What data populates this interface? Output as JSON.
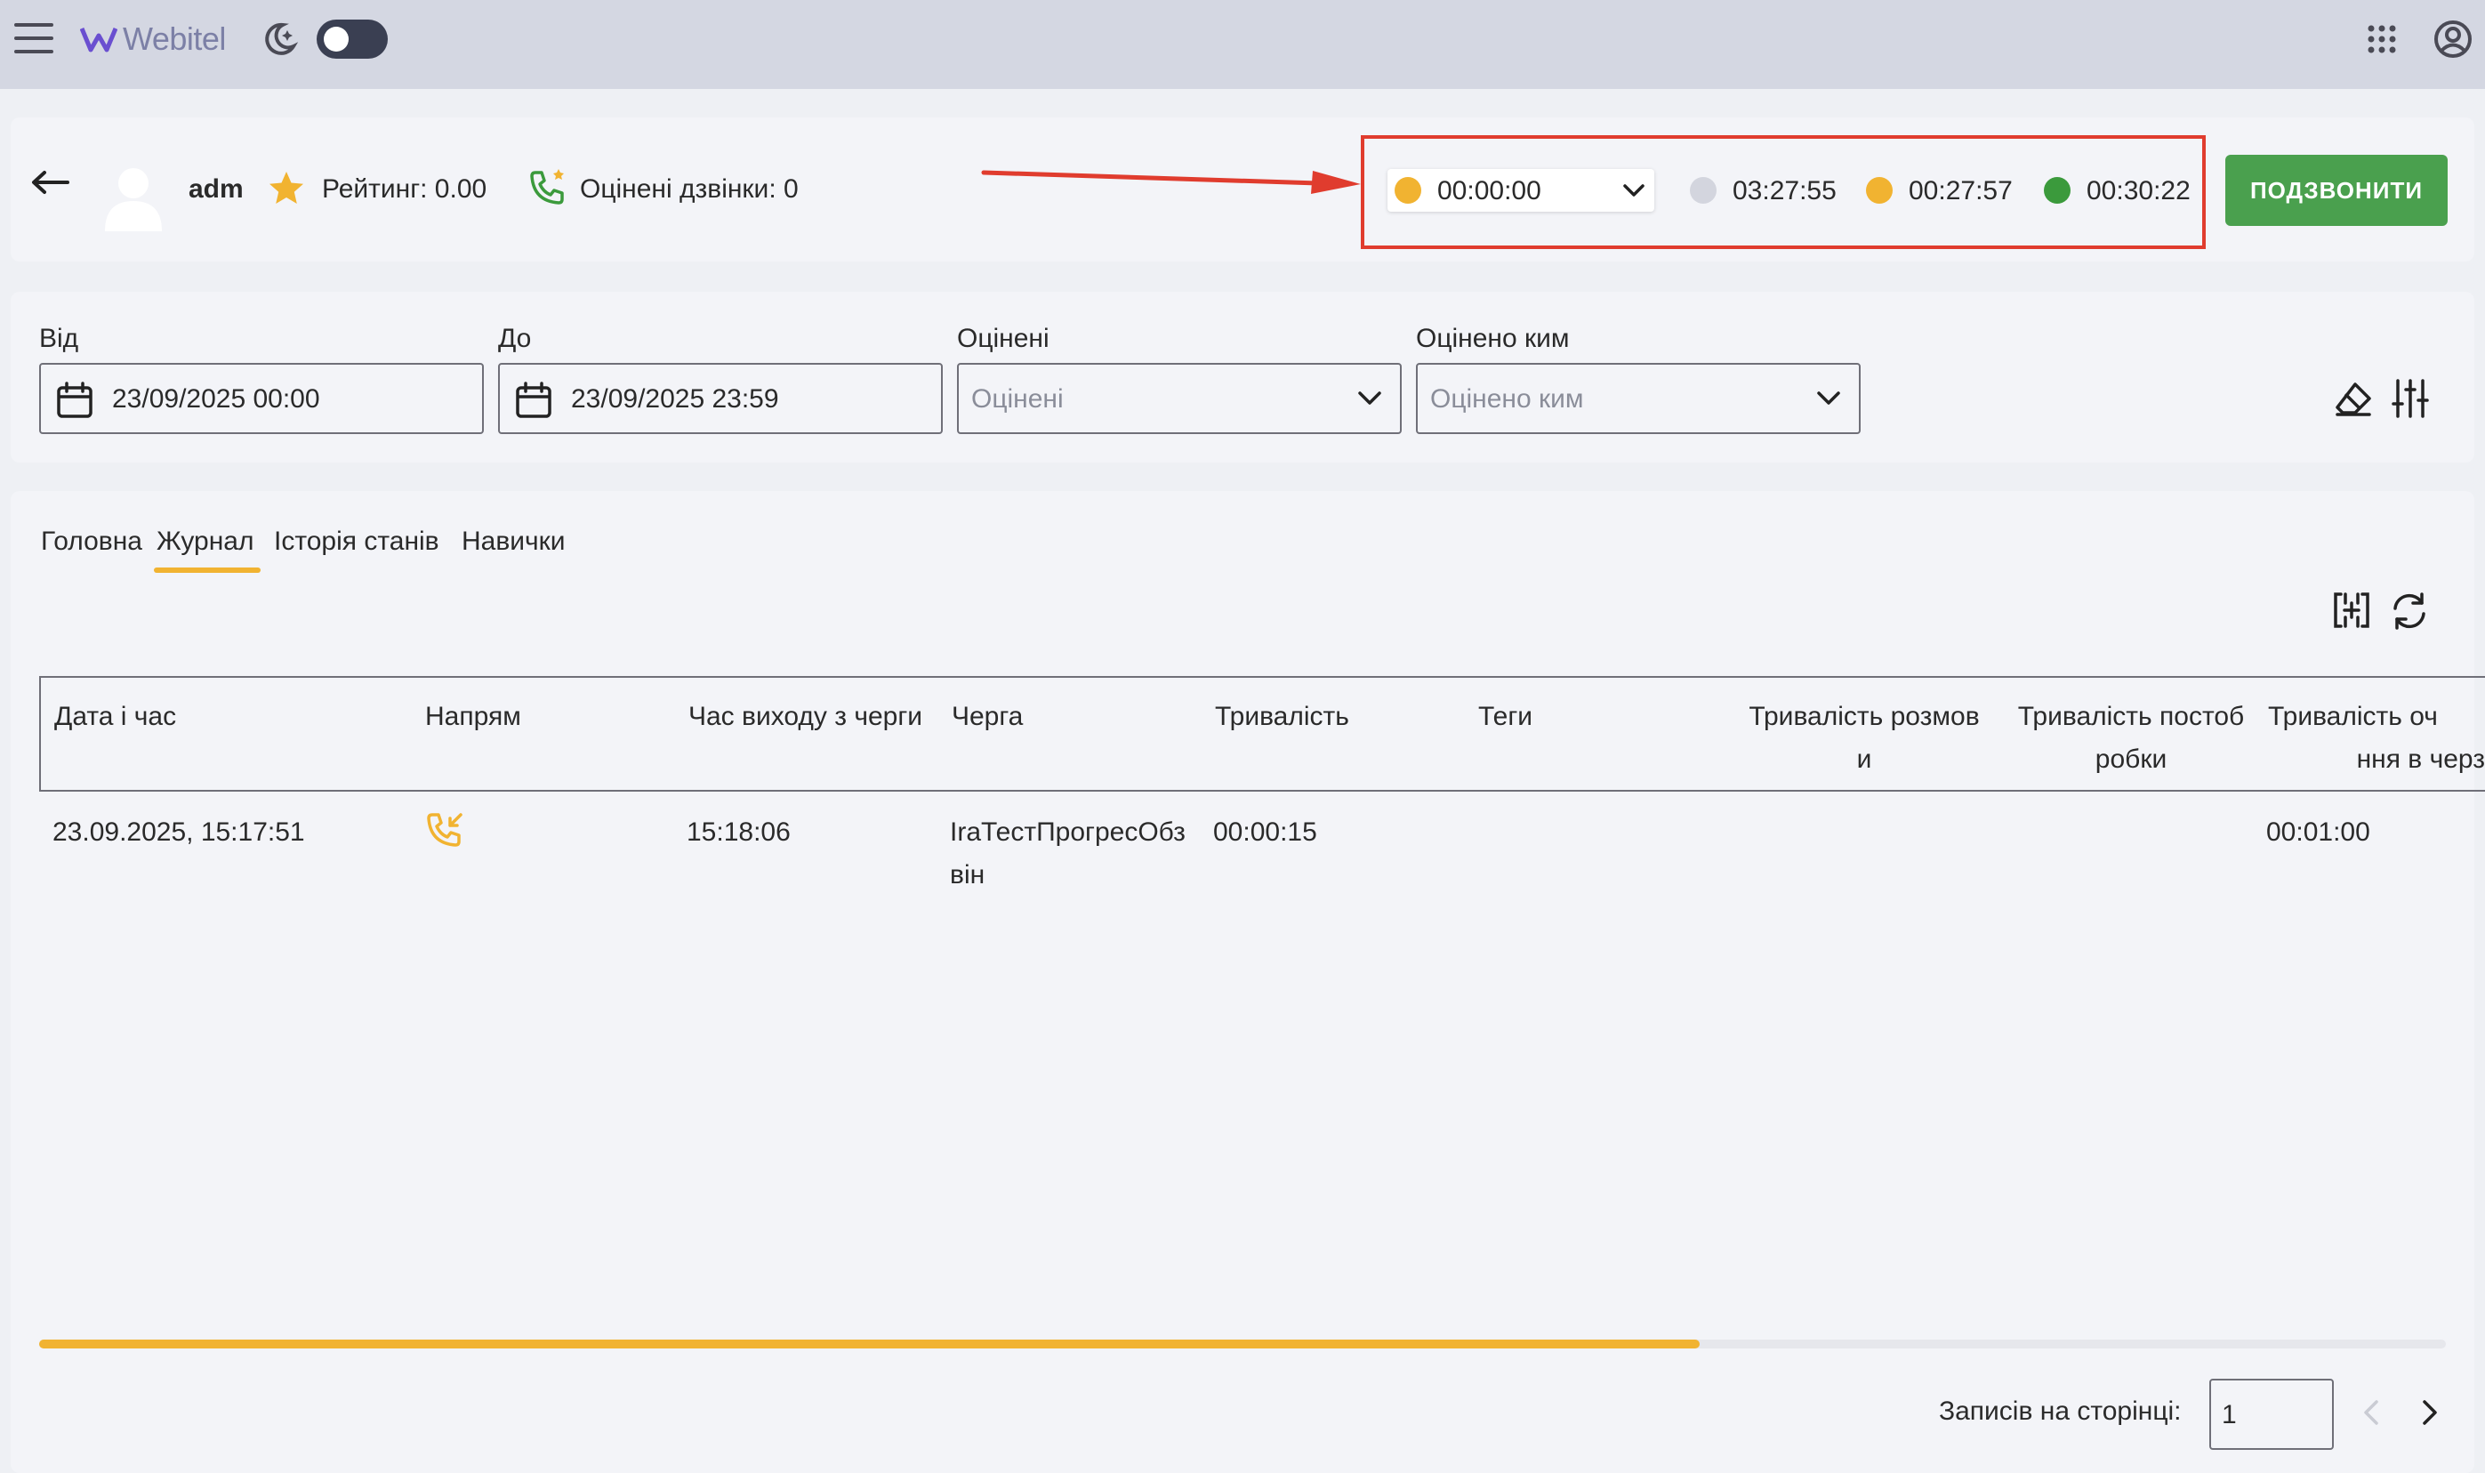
{
  "topbar": {
    "logo_text": "Webitel"
  },
  "agent": {
    "name": "adm",
    "rating": "Рейтинг: 0.00",
    "rated_calls": "Оцінені дзвінки: 0"
  },
  "status": {
    "current": "00:00:00",
    "current_color": "#f1b331",
    "timers": [
      {
        "value": "03:27:55",
        "color": "#d3d5de"
      },
      {
        "value": "00:27:57",
        "color": "#f1b331"
      },
      {
        "value": "00:30:22",
        "color": "#3b9a3c"
      }
    ],
    "call_button": "ПОДЗВОНИТИ"
  },
  "filters": {
    "from_label": "Від",
    "from_value": "23/09/2025 00:00",
    "to_label": "До",
    "to_value": "23/09/2025 23:59",
    "rated_label": "Оцінені",
    "rated_placeholder": "Оцінені",
    "rated_by_label": "Оцінено ким",
    "rated_by_placeholder": "Оцінено ким"
  },
  "tabs": [
    {
      "label": "Головна"
    },
    {
      "label": "Журнал"
    },
    {
      "label": "Історія станів"
    },
    {
      "label": "Навички"
    }
  ],
  "table": {
    "headers": {
      "datetime": "Дата і час",
      "direction": "Напрям",
      "queue_exit": "Час виходу з черги",
      "queue": "Черга",
      "duration": "Тривалість",
      "tags": "Теги",
      "talk_duration_1": "Тривалість розмов",
      "talk_duration_2": "и",
      "post_duration_1": "Тривалість постоб",
      "post_duration_2": "робки",
      "wait_duration_1": "Тривалість оч",
      "wait_duration_2": "ння в черз"
    },
    "row": {
      "datetime": "23.09.2025, 15:17:51",
      "queue_exit": "15:18:06",
      "queue_1": "IraТестПрогресОбз",
      "queue_2": "він",
      "duration": "00:00:15",
      "wait_duration": "00:01:00"
    }
  },
  "scroll_progress": 0.69,
  "pagination": {
    "per_page_label": "Записів на сторінці:",
    "per_page_value": "1"
  }
}
